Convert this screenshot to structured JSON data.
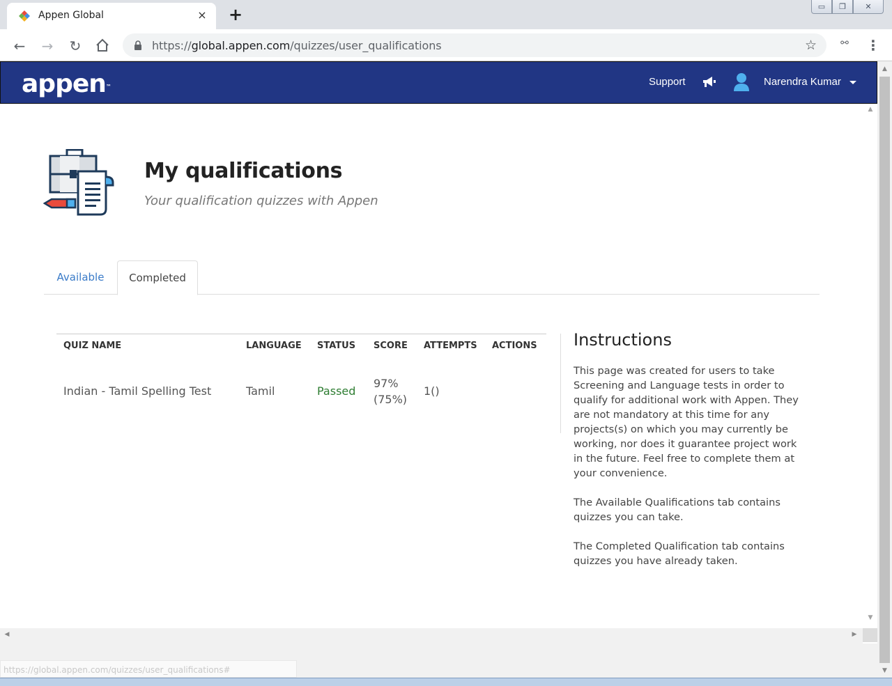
{
  "browser": {
    "tab_title": "Appen Global",
    "tab_close": "×",
    "new_tab": "+",
    "url_prefix": "https://",
    "url_host": "global.appen.com",
    "url_path": "/quizzes/user_qualifications",
    "status_url": "https://global.appen.com/quizzes/user_qualifications#"
  },
  "header": {
    "logo_text": "appen",
    "logo_tm": "™",
    "support_label": "Support",
    "user_name": "Narendra Kumar",
    "brand_color": "#213684"
  },
  "page": {
    "title": "My qualifications",
    "subtitle": "Your qualification quizzes with Appen"
  },
  "tabs": [
    {
      "label": "Available",
      "active": false
    },
    {
      "label": "Completed",
      "active": true
    }
  ],
  "table": {
    "headers": [
      "QUIZ NAME",
      "LANGUAGE",
      "STATUS",
      "SCORE",
      "ATTEMPTS",
      "ACTIONS"
    ],
    "rows": [
      {
        "quiz_name": "Indian - Tamil Spelling Test",
        "language": "Tamil",
        "status": "Passed",
        "score": "97%",
        "score_required": "(75%)",
        "attempts": "1()",
        "status_color": "#2e7d32"
      }
    ]
  },
  "instructions": {
    "title": "Instructions",
    "paragraphs": [
      "This page was created for users to take Screening and Language tests in order to qualify for additional work with Appen. They are not mandatory at this time for any projects(s) on which you may currently be working, nor does it guarantee project work in the future. Feel free to complete them at your convenience.",
      "The Available Qualifications tab contains quizzes you can take.",
      "The Completed Qualification tab contains quizzes you have already taken."
    ]
  }
}
